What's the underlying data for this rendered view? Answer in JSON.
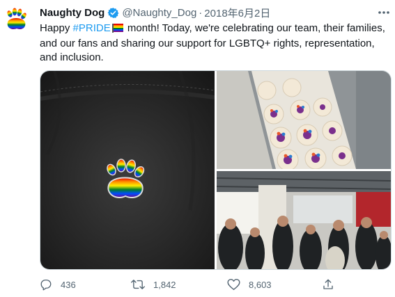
{
  "tweet": {
    "author_name": "Naughty Dog",
    "handle": "@Naughty_Dog",
    "separator": "·",
    "date": "2018年6月2日",
    "text_before_hashtag": "Happy ",
    "hashtag": "#PRIDE",
    "text_after_hashtag": " month! Today, we're celebrating our team, their families, and our fans and sharing our support for LGBTQ+ rights, representation, and inclusion."
  },
  "media": [
    {
      "icon": "rainbow-paw-pin-photo"
    },
    {
      "icon": "paw-cookies-box-photo"
    },
    {
      "icon": "office-gathering-photo"
    }
  ],
  "actions": {
    "reply_count": "436",
    "retweet_count": "1,842",
    "like_count": "8,603"
  },
  "colors": {
    "link": "#1d9bf0",
    "muted_text": "#536471",
    "border": "#cfd9de",
    "verified": "#1d9bf0"
  }
}
